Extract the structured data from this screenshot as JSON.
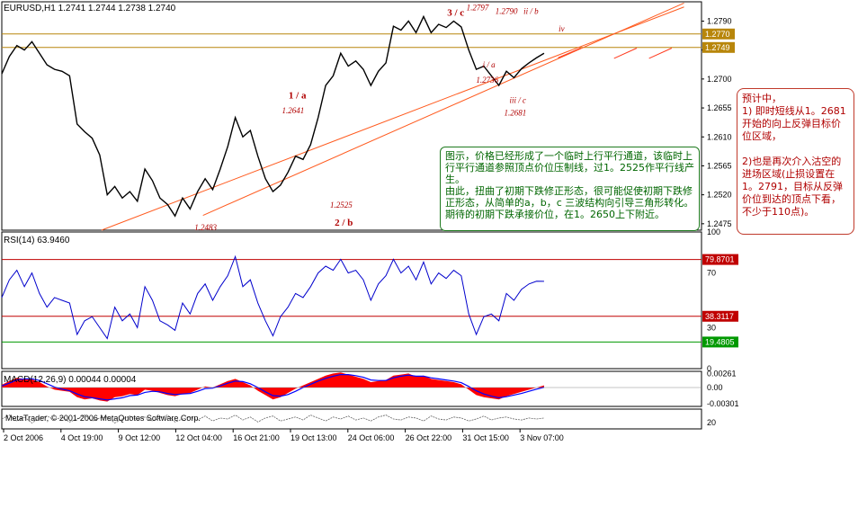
{
  "chart_data": [
    {
      "type": "line",
      "title": "EURUSD,H1  1.2741 1.2744 1.2738 1.2740",
      "ylim": [
        1.2465,
        1.282
      ],
      "y_ticks": [
        "1.2790",
        "1.2745",
        "1.2700",
        "1.2655",
        "1.2610",
        "1.2565",
        "1.2520",
        "1.2475"
      ],
      "y_tick_values": [
        1.279,
        1.2745,
        1.27,
        1.2655,
        1.261,
        1.2565,
        1.252,
        1.2475
      ],
      "x": [
        0,
        6,
        12,
        18,
        24,
        30,
        36,
        42,
        48,
        54,
        60,
        66,
        72,
        78,
        84,
        90,
        96,
        102,
        108,
        114,
        120,
        126,
        132,
        138,
        144,
        150,
        156,
        162,
        168,
        174,
        180,
        186,
        192,
        198,
        204,
        210,
        216,
        222,
        228,
        234,
        240,
        246,
        252,
        258,
        264,
        270,
        276,
        282,
        288,
        294,
        300,
        306,
        312,
        318,
        324,
        330,
        336,
        342,
        348,
        354,
        360,
        366,
        372,
        378,
        384,
        390,
        396,
        402,
        408,
        414,
        420,
        426,
        432
      ],
      "values": [
        1.2708,
        1.2735,
        1.2752,
        1.2745,
        1.2758,
        1.274,
        1.2722,
        1.2715,
        1.2712,
        1.2705,
        1.263,
        1.2618,
        1.2608,
        1.2582,
        1.252,
        1.2533,
        1.2515,
        1.2525,
        1.251,
        1.256,
        1.2542,
        1.2515,
        1.2505,
        1.2487,
        1.2515,
        1.2498,
        1.2525,
        1.2545,
        1.2528,
        1.256,
        1.2595,
        1.264,
        1.261,
        1.262,
        1.258,
        1.2545,
        1.2525,
        1.2535,
        1.2555,
        1.258,
        1.2575,
        1.2598,
        1.264,
        1.269,
        1.2705,
        1.274,
        1.272,
        1.2728,
        1.2715,
        1.269,
        1.2712,
        1.2725,
        1.2782,
        1.2776,
        1.279,
        1.2772,
        1.2797,
        1.2772,
        1.2785,
        1.278,
        1.279,
        1.2781,
        1.2745,
        1.2715,
        1.272,
        1.2705,
        1.269,
        1.2712,
        1.2702,
        1.2716,
        1.2725,
        1.2733,
        1.274
      ],
      "horizontal_lines": [
        {
          "label": "1.2770",
          "value": 1.277,
          "color": "#b8860b"
        },
        {
          "label": "1.2749",
          "value": 1.2749,
          "color": "#b8860b"
        }
      ],
      "last_price": "1.2740",
      "trend_lines": [
        {
          "from": [
            114,
            1.2465
          ],
          "to": [
            780,
            1.2812
          ],
          "color": "#ff5a1e"
        },
        {
          "from": [
            230,
            1.2488
          ],
          "to": [
            780,
            1.2818
          ],
          "color": "#ff5a1e"
        }
      ],
      "segments": [
        {
          "from": [
            636,
            1.2733
          ],
          "to": [
            662,
            1.2748
          ]
        },
        {
          "from": [
            700,
            1.2732
          ],
          "to": [
            726,
            1.2748
          ]
        },
        {
          "from": [
            740,
            1.2732
          ],
          "to": [
            766,
            1.2748
          ]
        }
      ],
      "annotations": [
        {
          "text": "1 / a",
          "x": 338,
          "y": 1.267,
          "style": "bold"
        },
        {
          "text": "1.2641",
          "x": 333,
          "y": 1.2647,
          "style": "italic"
        },
        {
          "text": "3 / c",
          "x": 519,
          "y": 1.2798,
          "style": "bold"
        },
        {
          "text": "1.2797",
          "x": 544,
          "y": 1.2807,
          "style": "italic"
        },
        {
          "text": "1.2790",
          "x": 577,
          "y": 1.2801,
          "style": "italic"
        },
        {
          "text": "ii / b",
          "x": 605,
          "y": 1.2801,
          "style": "italic"
        },
        {
          "text": "iv",
          "x": 640,
          "y": 1.2774,
          "style": "italic"
        },
        {
          "text": "i / a",
          "x": 557,
          "y": 1.2718,
          "style": "italic"
        },
        {
          "text": "1.2736",
          "x": 555,
          "y": 1.2694,
          "style": "italic"
        },
        {
          "text": "iii / c",
          "x": 590,
          "y": 1.2663,
          "style": "italic"
        },
        {
          "text": "1.2681",
          "x": 587,
          "y": 1.2643,
          "style": "italic"
        },
        {
          "text": "1.2525",
          "x": 388,
          "y": 1.25,
          "style": "italic"
        },
        {
          "text": "2 / b",
          "x": 391,
          "y": 1.2472,
          "style": "bold"
        },
        {
          "text": "1.2483",
          "x": 233,
          "y": 1.2465,
          "style": "italic"
        }
      ]
    },
    {
      "type": "line",
      "title": "RSI(14) 63.9460",
      "ylim": [
        0,
        100
      ],
      "y_ticks": [
        "100",
        "70",
        "30",
        "0"
      ],
      "y_tick_values": [
        100,
        70,
        30,
        0
      ],
      "levels": [
        {
          "label": "79.8701",
          "value": 79.8701,
          "color": "#c00000"
        },
        {
          "label": "38.3117",
          "value": 38.3117,
          "color": "#c00000"
        },
        {
          "label": "19.4805",
          "value": 19.4805,
          "color": "#009900"
        }
      ],
      "x": [
        0,
        6,
        12,
        18,
        24,
        30,
        36,
        42,
        48,
        54,
        60,
        66,
        72,
        78,
        84,
        90,
        96,
        102,
        108,
        114,
        120,
        126,
        132,
        138,
        144,
        150,
        156,
        162,
        168,
        174,
        180,
        186,
        192,
        198,
        204,
        210,
        216,
        222,
        228,
        234,
        240,
        246,
        252,
        258,
        264,
        270,
        276,
        282,
        288,
        294,
        300,
        306,
        312,
        318,
        324,
        330,
        336,
        342,
        348,
        354,
        360,
        366,
        372,
        378,
        384,
        390,
        396,
        402,
        408,
        414,
        420,
        426,
        432
      ],
      "values": [
        52,
        65,
        72,
        60,
        70,
        55,
        45,
        52,
        50,
        48,
        25,
        35,
        38,
        30,
        22,
        45,
        35,
        40,
        30,
        60,
        50,
        35,
        32,
        28,
        48,
        40,
        55,
        62,
        50,
        60,
        68,
        82,
        60,
        65,
        48,
        35,
        24,
        38,
        45,
        55,
        52,
        60,
        70,
        75,
        72,
        80,
        70,
        72,
        65,
        50,
        62,
        68,
        80,
        70,
        75,
        65,
        78,
        62,
        70,
        66,
        72,
        68,
        40,
        25,
        38,
        40,
        35,
        55,
        50,
        58,
        62,
        64,
        63.9
      ]
    },
    {
      "type": "area",
      "title": "MACD(12,26,9) 0.00044 0.00004",
      "ylim": [
        -0.0035,
        0.003
      ],
      "y_ticks": [
        "0.00261",
        "0.00",
        "-0.00301"
      ],
      "y_tick_values": [
        0.00261,
        0.0,
        -0.00301
      ],
      "x": [
        0,
        6,
        12,
        18,
        24,
        30,
        36,
        42,
        48,
        54,
        60,
        66,
        72,
        78,
        84,
        90,
        96,
        102,
        108,
        114,
        120,
        126,
        132,
        138,
        144,
        150,
        156,
        162,
        168,
        174,
        180,
        186,
        192,
        198,
        204,
        210,
        216,
        222,
        228,
        234,
        240,
        246,
        252,
        258,
        264,
        270,
        276,
        282,
        288,
        294,
        300,
        306,
        312,
        318,
        324,
        330,
        336,
        342,
        348,
        354,
        360,
        366,
        372,
        378,
        384,
        390,
        396,
        402,
        408,
        414,
        420,
        426,
        432
      ],
      "values": [
        0.0005,
        0.0012,
        0.0018,
        0.0016,
        0.0015,
        0.001,
        0.0002,
        -0.0004,
        -0.0006,
        -0.0008,
        -0.0018,
        -0.0022,
        -0.002,
        -0.0024,
        -0.0026,
        -0.0018,
        -0.0016,
        -0.0012,
        -0.0014,
        -0.0004,
        -0.0006,
        -0.001,
        -0.0014,
        -0.0016,
        -0.0012,
        -0.001,
        -0.0004,
        0.0002,
        0.0,
        0.0006,
        0.0012,
        0.0016,
        0.001,
        0.0004,
        -0.0006,
        -0.0014,
        -0.0022,
        -0.0018,
        -0.001,
        -0.0002,
        0.0004,
        0.001,
        0.0016,
        0.0022,
        0.0026,
        0.0028,
        0.0024,
        0.002,
        0.0016,
        0.001,
        0.0012,
        0.0014,
        0.0022,
        0.0024,
        0.0026,
        0.002,
        0.0022,
        0.0016,
        0.0014,
        0.0012,
        0.001,
        0.0006,
        -0.0004,
        -0.0014,
        -0.0018,
        -0.002,
        -0.0022,
        -0.0016,
        -0.0012,
        -0.0008,
        -0.0004,
        0.0,
        0.0004
      ],
      "signal": [
        0.0003,
        0.0008,
        0.0014,
        0.0016,
        0.0016,
        0.0013,
        0.0007,
        0.0001,
        -0.0003,
        -0.0006,
        -0.0012,
        -0.0017,
        -0.0019,
        -0.0021,
        -0.0023,
        -0.0021,
        -0.0019,
        -0.0015,
        -0.0014,
        -0.0009,
        -0.0007,
        -0.0008,
        -0.0011,
        -0.0013,
        -0.0012,
        -0.0011,
        -0.0007,
        -0.0002,
        -0.0001,
        0.0003,
        0.0008,
        0.0012,
        0.0011,
        0.0007,
        0.0,
        -0.0008,
        -0.0015,
        -0.0016,
        -0.0013,
        -0.0007,
        0.0,
        0.0006,
        0.0012,
        0.0017,
        0.0021,
        0.0024,
        0.0024,
        0.0022,
        0.0019,
        0.0014,
        0.0013,
        0.0013,
        0.0018,
        0.0021,
        0.0023,
        0.0021,
        0.0021,
        0.0018,
        0.0016,
        0.0014,
        0.0012,
        0.0009,
        0.0002,
        -0.0006,
        -0.0012,
        -0.0016,
        -0.0019,
        -0.0017,
        -0.0014,
        -0.0011,
        -0.0007,
        -0.0003,
        4e-05
      ],
      "colors": {
        "histogram": "#ff0000",
        "signal": "#0000ff"
      }
    },
    {
      "type": "line",
      "title": "MetaTrader, © 2001-2006 MetaQuotes Software Corp.",
      "ylim": [
        0,
        100
      ],
      "x": [
        0,
        6,
        12,
        18,
        24,
        30,
        36,
        42,
        48,
        54,
        60,
        66,
        72,
        78,
        84,
        90,
        96,
        102,
        108,
        114,
        120,
        126,
        132,
        138,
        144,
        150,
        156,
        162,
        168,
        174,
        180,
        186,
        192,
        198,
        204,
        210,
        216,
        222,
        228,
        234,
        240,
        246,
        252,
        258,
        264,
        270,
        276,
        282,
        288,
        294,
        300,
        306,
        312,
        318,
        324,
        330,
        336,
        342,
        348,
        354,
        360,
        366,
        372,
        378,
        384,
        390,
        396,
        402,
        408,
        414,
        420,
        426,
        432
      ],
      "values": [
        50,
        70,
        40,
        60,
        30,
        55,
        65,
        45,
        60,
        35,
        50,
        70,
        40,
        55,
        60,
        30,
        50,
        65,
        45,
        60,
        40,
        55,
        70,
        35,
        50,
        60,
        45,
        65,
        40,
        55,
        50,
        70,
        45,
        60,
        35,
        55,
        65,
        40,
        50,
        60,
        45,
        70,
        55,
        40,
        60,
        50,
        65,
        45,
        55,
        40,
        60,
        70,
        50,
        45,
        60,
        55,
        40,
        65,
        50,
        45,
        60,
        55,
        40,
        50,
        65,
        45,
        55,
        60,
        50,
        45,
        55,
        50,
        55
      ],
      "y_ticks": [
        "20"
      ],
      "colors": {
        "lines": "#666666"
      }
    }
  ],
  "x_axis_labels": [
    "2 Oct 2006",
    "4 Oct 19:00",
    "9 Oct 12:00",
    "12 Oct 04:00",
    "16 Oct 21:00",
    "19 Oct 13:00",
    "24 Oct 06:00",
    "26 Oct 22:00",
    "31 Oct 15:00",
    "3 Nov 07:00"
  ],
  "notes": {
    "green": "图示，价格已经形成了一个临时上行平行通道，该临时上行平行通道参照顶点价位压制线，过1。2525作平行线产生。\n由此，扭曲了初期下跌修正形态，很可能促使初期下跌修正形态，从简单的a，b，c 三波结构向引导三角形转化。期待的初期下跌承接价位，在1。2650上下附近。",
    "red": "预计中，\n1) 即时短线从1。2681开始的向上反弹目标价位区域，\n\n2)也是再次介入沽空的进场区域(止损设置在1。2791，目标从反弹价位到达的顶点下看，不少于110点)。"
  },
  "colors": {
    "price": "#000000",
    "rsi": "#0000cc",
    "grid": "#808080",
    "annot": "#b00000",
    "green_note": "#006600"
  }
}
